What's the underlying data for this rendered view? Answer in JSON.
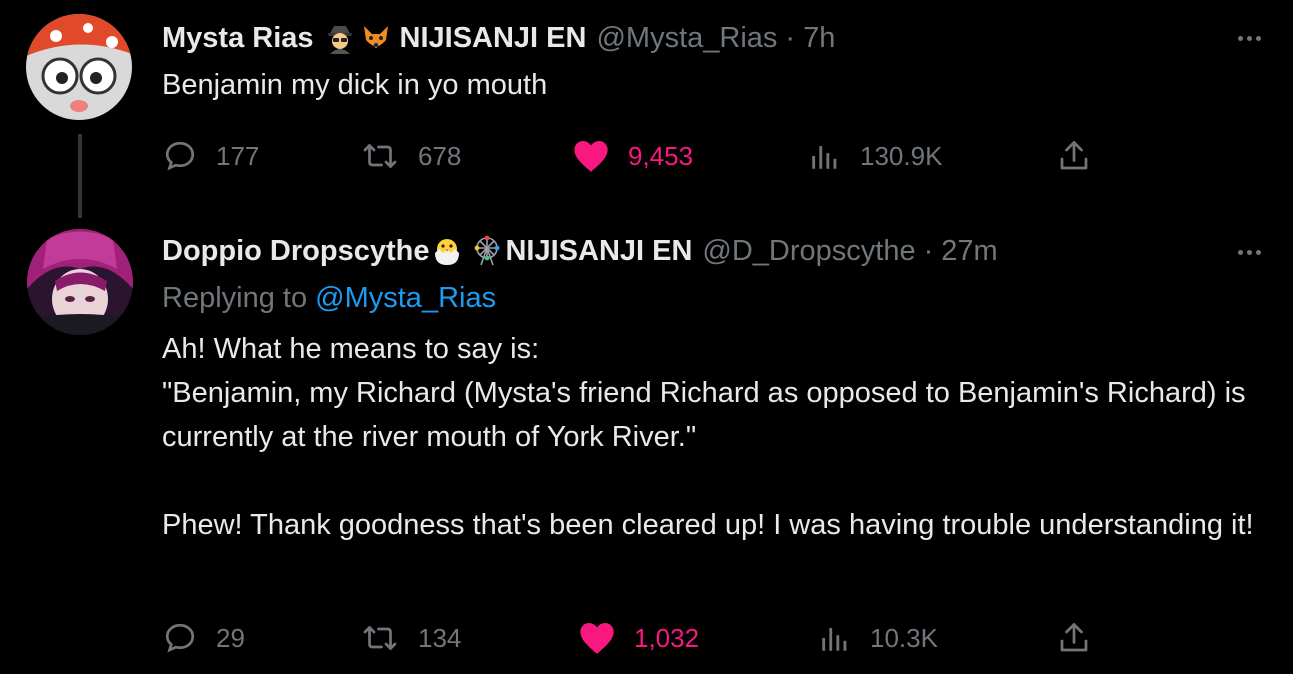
{
  "tweets": [
    {
      "name": "Mysta Rias",
      "org": "NIJISANJI EN",
      "handle": "@Mysta_Rias",
      "separator": "·",
      "time": "7h",
      "text": "Benjamin my dick in yo mouth",
      "stats": {
        "replies": "177",
        "retweets": "678",
        "likes": "9,453",
        "views": "130.9K"
      },
      "liked": true
    },
    {
      "name": "Doppio Dropscythe",
      "org": "NIJISANJI EN",
      "handle": "@D_Dropscythe",
      "separator": "·",
      "time": "27m",
      "replying_prefix": "Replying to ",
      "replying_to": "@Mysta_Rias",
      "text": "Ah! What he means to say is:\n\"Benjamin, my Richard (Mysta's friend Richard as opposed to Benjamin's Richard) is currently at the river mouth of York River.\"\n\nPhew! Thank goodness that's been cleared up! I was having trouble understanding it!",
      "stats": {
        "replies": "29",
        "retweets": "134",
        "likes": "1,032",
        "views": "10.3K"
      },
      "liked": true
    }
  ],
  "colors": {
    "background": "#000000",
    "text": "#e7e9ea",
    "muted": "#71767b",
    "link": "#1d9bf0",
    "like": "#f91880"
  },
  "icons": [
    "reply-icon",
    "retweet-icon",
    "heart-icon",
    "views-icon",
    "share-icon",
    "more-icon",
    "spy-emoji",
    "fox-emoji",
    "chick-emoji",
    "ferris-wheel-emoji"
  ]
}
